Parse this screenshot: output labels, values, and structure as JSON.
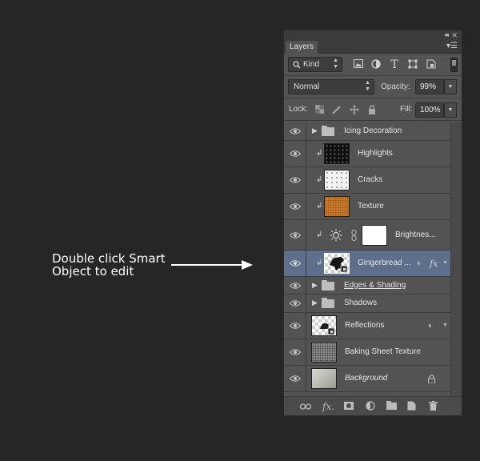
{
  "annotation": {
    "line1": "Double click Smart",
    "line2": "Object to edit"
  },
  "panel": {
    "tab_label": "Layers",
    "filter": {
      "kind_label": "Kind",
      "search_icon": "magnifier-icon"
    },
    "blend_mode": "Normal",
    "opacity_label": "Opacity:",
    "opacity_value": "99%",
    "lock_label": "Lock:",
    "fill_label": "Fill:",
    "fill_value": "100%"
  },
  "layers": [
    {
      "name": "Icing Decoration",
      "type": "group"
    },
    {
      "name": "Highlights",
      "type": "layer"
    },
    {
      "name": "Cracks",
      "type": "layer"
    },
    {
      "name": "Texture",
      "type": "layer"
    },
    {
      "name": "Brightnes...",
      "type": "adjustment"
    },
    {
      "name": "Gingerbread ...",
      "type": "smart-object",
      "selected": true,
      "fx": "fx"
    },
    {
      "name": "Edges & Shading",
      "type": "group"
    },
    {
      "name": "Shadows",
      "type": "group"
    },
    {
      "name": "Reflections",
      "type": "smart-object"
    },
    {
      "name": "Baking Sheet Texture",
      "type": "layer"
    },
    {
      "name": "Background",
      "type": "background"
    }
  ],
  "colors": {
    "panel_bg": "#535353",
    "selected_row": "#5d6f8b",
    "page_bg": "#262626"
  }
}
